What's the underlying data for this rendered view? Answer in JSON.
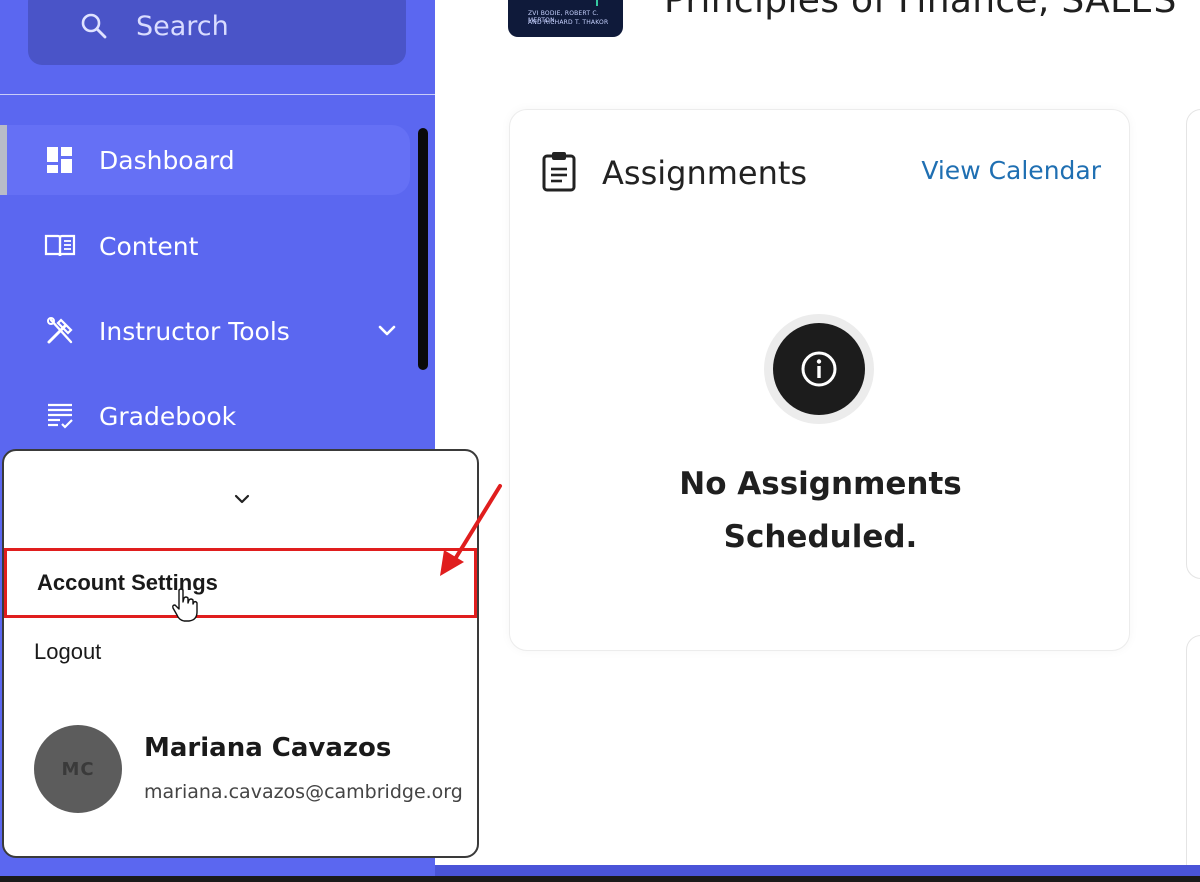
{
  "search": {
    "placeholder": "Search"
  },
  "sidebar": {
    "items": [
      {
        "label": "Dashboard",
        "icon": "dashboard-icon",
        "active": true
      },
      {
        "label": "Content",
        "icon": "book-icon"
      },
      {
        "label": "Instructor Tools",
        "icon": "tools-icon",
        "has_submenu": true
      },
      {
        "label": "Gradebook",
        "icon": "gradebook-icon"
      }
    ]
  },
  "header": {
    "course_title": "Principles of Finance, SALES",
    "book_cover": {
      "authors_line1": "ZVI BODIE, ROBERT C. MERTON",
      "authors_line2": "AND RICHARD T. THAKOR"
    }
  },
  "assignments_card": {
    "title": "Assignments",
    "link": "View Calendar",
    "empty_line1": "No Assignments",
    "empty_line2": "Scheduled."
  },
  "account_menu": {
    "options": [
      {
        "label": "Account Settings"
      },
      {
        "label": "Logout"
      }
    ],
    "user": {
      "initials": "MC",
      "name": "Mariana Cavazos",
      "email": "mariana.cavazos@cambridge.org"
    }
  },
  "colors": {
    "sidebar_bg": "#5b67f0",
    "link": "#1f6fb2",
    "highlight_border": "#e01e1e",
    "annotation_arrow": "#e01e1e"
  }
}
